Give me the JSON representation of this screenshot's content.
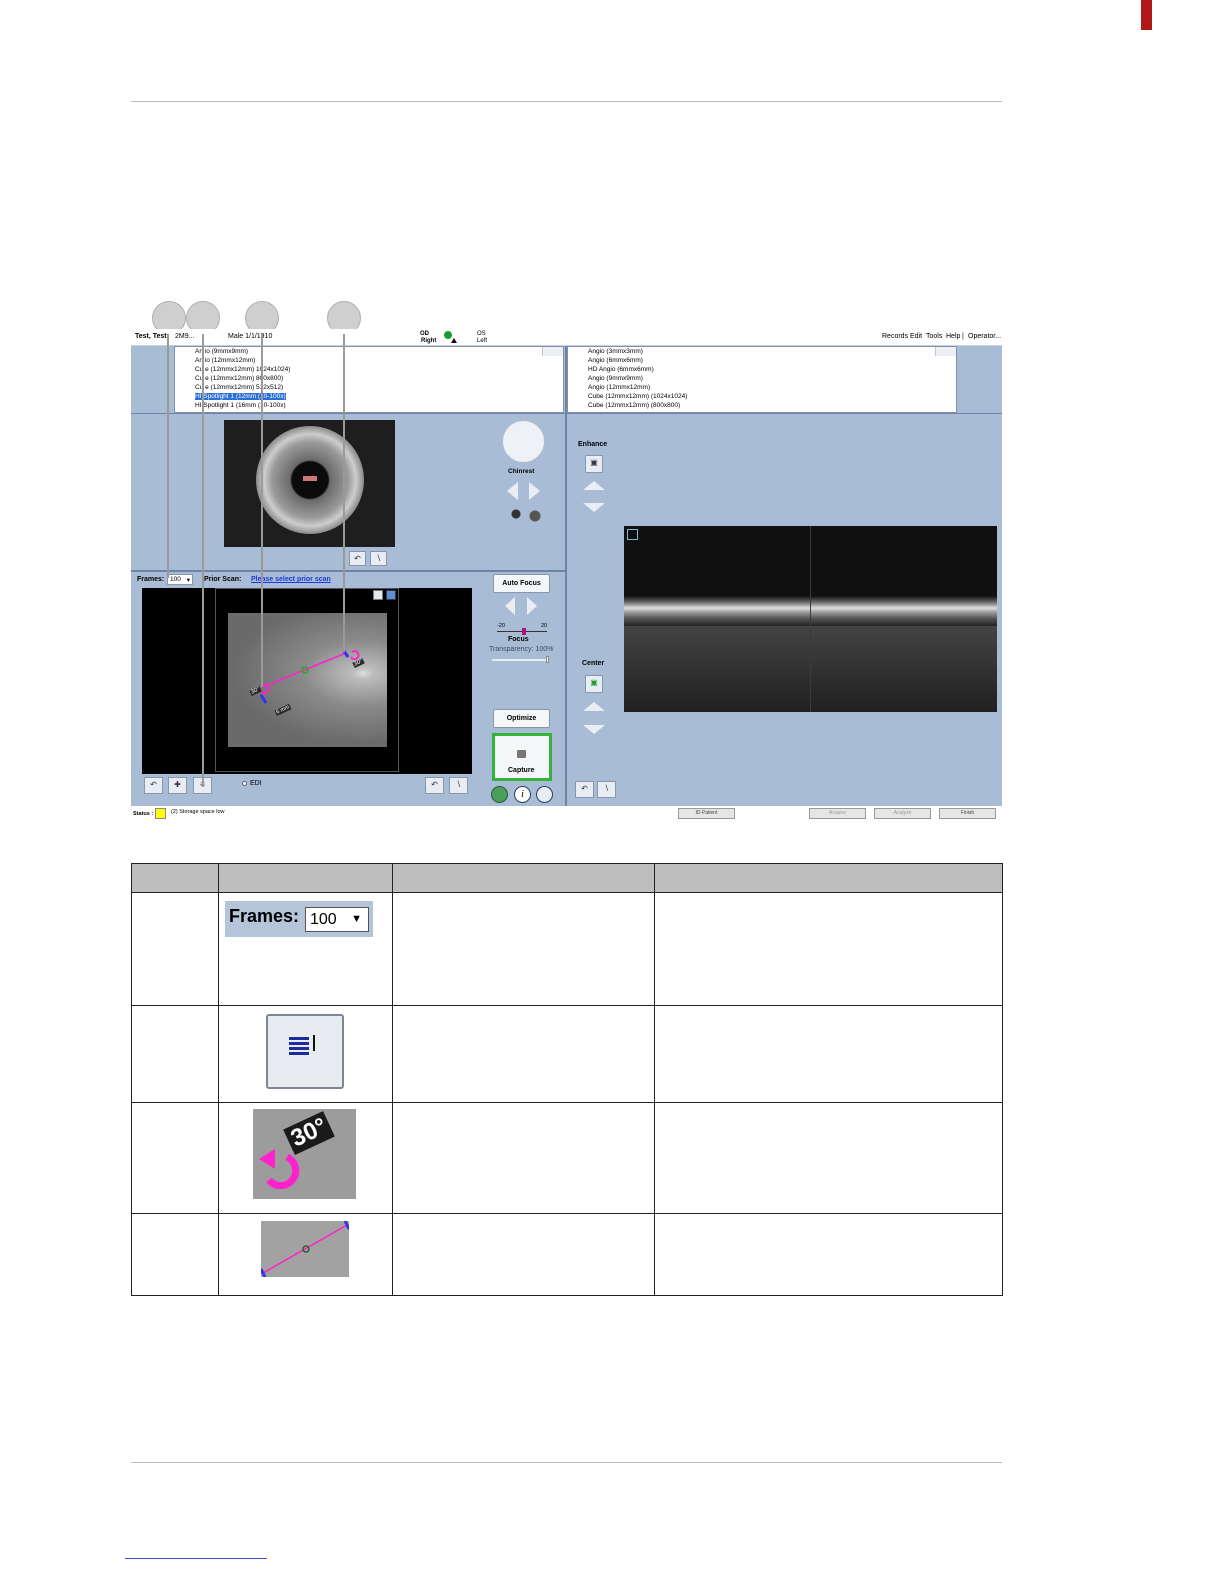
{
  "screenshot": {
    "title_bar": {
      "patient": "Test, Test",
      "patient_id_partial": "2M9...",
      "sex_dob": "Male   1/1/1910",
      "eye_od": "OD",
      "eye_od_label": "Right",
      "eye_os": "OS",
      "eye_os_label": "Left",
      "menu": [
        "Records",
        "Edit",
        "Tools",
        "Help",
        "|",
        "Operator..."
      ]
    },
    "left_scan_list": [
      "Angio (9mmx9mm)",
      "Angio (12mmx12mm)",
      "Cube (12mmx12mm) (1024x1024)",
      "Cube (12mmx12mm) (800x800)",
      "Cube (12mmx12mm) (512x512)",
      "HD Spotlight 1 (12mm) (10-100x)",
      "HD Spotlight 1 (16mm) (10-100x)"
    ],
    "left_scan_list_visible": [
      "An  io (9mmx9mm)",
      "An  io (12mmx12mm)",
      "Cu  e (12mmx12mm)  1024x1024)",
      "Cu  e (12mmx12mm)  800x800)",
      "Cu  e (12mmx12mm)  512x512)",
      "HI  Spotlight 1 (12mm  (10-100x)",
      "HI  Spotlight 1 (16mm  (10-100x)"
    ],
    "left_scan_selected_index": 5,
    "right_scan_list": [
      "Angio (3mmx3mm)",
      "Angio (6mmx6mm)",
      "HD Angio (6mmx6mm)",
      "Angio (9mmx9mm)",
      "Angio (12mmx12mm)",
      "Cube (12mmx12mm) (1024x1024)",
      "Cube (12mmx12mm) (800x800)"
    ],
    "chinrest_label": "Chinrest",
    "enhance_label": "Enhance",
    "center_label": "Center",
    "frames_label": "Frames:",
    "frames_value": "100",
    "prior_scan_label": "Prior Scan:",
    "prior_scan_link": "Please select prior scan",
    "auto_focus_label": "Auto Focus",
    "focus_scale_min": "-20",
    "focus_scale_max": "20",
    "focus_label": "Focus",
    "transparency_label": "Transparency: 100%",
    "transparency_level": 1.0,
    "optimize_label": "Optimize",
    "capture_label": "Capture",
    "edi_label": "EDI",
    "angle_left": "30°",
    "angle_right": "30°",
    "scan_length": "6 mm",
    "status_label": "Status :",
    "status_text": "(2) Storage space low",
    "status_color": "#ffff00",
    "id_patient_label": "ID Patient",
    "acquire_label": "Acquire",
    "analyze_label": "Analyze",
    "finish_label": "Finish",
    "capture_border_color": "#34b33a",
    "scan_line_color": "#ff22cc"
  },
  "table": {
    "row1_frames_label": "Frames:",
    "row1_frames_value": "100",
    "row3_angle": "30°"
  }
}
